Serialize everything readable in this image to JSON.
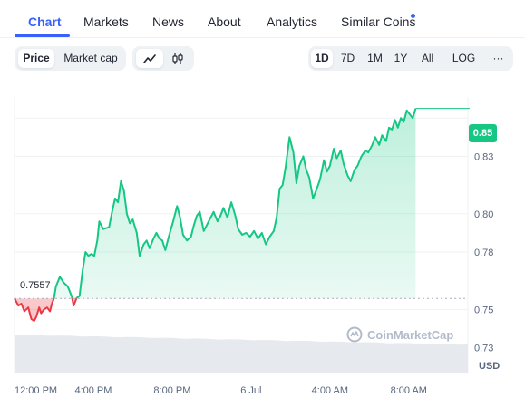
{
  "tabs": [
    {
      "label": "Chart",
      "active": true
    },
    {
      "label": "Markets",
      "active": false
    },
    {
      "label": "News",
      "active": false
    },
    {
      "label": "About",
      "active": false
    },
    {
      "label": "Analytics",
      "active": false
    },
    {
      "label": "Similar Coins",
      "active": false,
      "has_dot": true
    }
  ],
  "metric_toggle": {
    "options": [
      "Price",
      "Market cap"
    ],
    "selected": "Price"
  },
  "chart_style_toggle": {
    "options": [
      "line-chart-icon",
      "candlestick-icon"
    ],
    "selected": "line-chart-icon"
  },
  "range": {
    "options": [
      "1D",
      "7D",
      "1M",
      "1Y",
      "All"
    ],
    "selected": "1D",
    "log_label": "LOG",
    "more_label": "···"
  },
  "currency": "USD",
  "watermark": "CoinMarketCap",
  "colors": {
    "accent": "#3861fb",
    "up": "#16c784",
    "down": "#ea3943",
    "axis_text": "#58667e",
    "grid": "#eff2f5"
  },
  "chart_data": {
    "type": "line",
    "series": [
      {
        "name": "",
        "open": 0.7557,
        "current": 0.85
      }
    ],
    "current_price_label": "0.85",
    "open_price_label": "0.7557",
    "y_ticks": [
      "0.85",
      "0.83",
      "0.80",
      "0.78",
      "0.75",
      "0.73"
    ],
    "y_tick_values": [
      0.85,
      0.83,
      0.8,
      0.78,
      0.75,
      0.73
    ],
    "x_ticks": [
      "12:00 PM",
      "4:00 PM",
      "8:00 PM",
      "6 Jul",
      "4:00 AM",
      "8:00 AM"
    ],
    "x_tick_hours": [
      12,
      16,
      20,
      24,
      28,
      32
    ],
    "x_range_hours": [
      12,
      35
    ],
    "ylim": [
      0.717,
      0.861
    ],
    "grid": true,
    "points": [
      [
        12.0,
        0.7557
      ],
      [
        12.2,
        0.752
      ],
      [
        12.35,
        0.753
      ],
      [
        12.5,
        0.749
      ],
      [
        12.7,
        0.751
      ],
      [
        12.85,
        0.745
      ],
      [
        13.0,
        0.744
      ],
      [
        13.1,
        0.746
      ],
      [
        13.25,
        0.751
      ],
      [
        13.35,
        0.748
      ],
      [
        13.5,
        0.75
      ],
      [
        13.65,
        0.751
      ],
      [
        13.8,
        0.749
      ],
      [
        13.9,
        0.753
      ],
      [
        14.0,
        0.7557
      ],
      [
        14.1,
        0.762
      ],
      [
        14.3,
        0.767
      ],
      [
        14.5,
        0.764
      ],
      [
        14.7,
        0.762
      ],
      [
        14.9,
        0.757
      ],
      [
        15.0,
        0.752
      ],
      [
        15.15,
        0.756
      ],
      [
        15.3,
        0.757
      ],
      [
        15.45,
        0.77
      ],
      [
        15.6,
        0.78
      ],
      [
        15.75,
        0.778
      ],
      [
        15.9,
        0.779
      ],
      [
        16.05,
        0.778
      ],
      [
        16.2,
        0.786
      ],
      [
        16.3,
        0.796
      ],
      [
        16.5,
        0.792
      ],
      [
        16.8,
        0.793
      ],
      [
        16.95,
        0.801
      ],
      [
        17.1,
        0.808
      ],
      [
        17.25,
        0.806
      ],
      [
        17.4,
        0.817
      ],
      [
        17.55,
        0.812
      ],
      [
        17.7,
        0.8
      ],
      [
        17.85,
        0.795
      ],
      [
        18.0,
        0.797
      ],
      [
        18.2,
        0.79
      ],
      [
        18.35,
        0.778
      ],
      [
        18.55,
        0.784
      ],
      [
        18.7,
        0.786
      ],
      [
        18.85,
        0.782
      ],
      [
        19.05,
        0.787
      ],
      [
        19.2,
        0.79
      ],
      [
        19.35,
        0.787
      ],
      [
        19.5,
        0.786
      ],
      [
        19.65,
        0.781
      ],
      [
        19.85,
        0.789
      ],
      [
        20.05,
        0.796
      ],
      [
        20.25,
        0.804
      ],
      [
        20.4,
        0.798
      ],
      [
        20.55,
        0.789
      ],
      [
        20.75,
        0.786
      ],
      [
        20.95,
        0.788
      ],
      [
        21.1,
        0.794
      ],
      [
        21.25,
        0.799
      ],
      [
        21.4,
        0.801
      ],
      [
        21.6,
        0.791
      ],
      [
        21.75,
        0.794
      ],
      [
        21.95,
        0.798
      ],
      [
        22.1,
        0.801
      ],
      [
        22.3,
        0.796
      ],
      [
        22.45,
        0.799
      ],
      [
        22.6,
        0.803
      ],
      [
        22.8,
        0.798
      ],
      [
        23.0,
        0.806
      ],
      [
        23.2,
        0.799
      ],
      [
        23.35,
        0.792
      ],
      [
        23.55,
        0.789
      ],
      [
        23.75,
        0.79
      ],
      [
        23.95,
        0.788
      ],
      [
        24.15,
        0.791
      ],
      [
        24.35,
        0.787
      ],
      [
        24.55,
        0.79
      ],
      [
        24.75,
        0.784
      ],
      [
        24.95,
        0.788
      ],
      [
        25.15,
        0.791
      ],
      [
        25.3,
        0.798
      ],
      [
        25.45,
        0.813
      ],
      [
        25.6,
        0.815
      ],
      [
        25.75,
        0.824
      ],
      [
        25.95,
        0.84
      ],
      [
        26.15,
        0.832
      ],
      [
        26.3,
        0.816
      ],
      [
        26.45,
        0.825
      ],
      [
        26.65,
        0.83
      ],
      [
        26.8,
        0.823
      ],
      [
        26.95,
        0.819
      ],
      [
        27.15,
        0.808
      ],
      [
        27.3,
        0.812
      ],
      [
        27.5,
        0.818
      ],
      [
        27.7,
        0.828
      ],
      [
        27.85,
        0.822
      ],
      [
        28.0,
        0.825
      ],
      [
        28.2,
        0.834
      ],
      [
        28.35,
        0.829
      ],
      [
        28.55,
        0.833
      ],
      [
        28.7,
        0.826
      ],
      [
        28.9,
        0.82
      ],
      [
        29.05,
        0.817
      ],
      [
        29.25,
        0.823
      ],
      [
        29.4,
        0.825
      ],
      [
        29.6,
        0.83
      ],
      [
        29.8,
        0.833
      ],
      [
        29.95,
        0.832
      ],
      [
        30.15,
        0.836
      ],
      [
        30.3,
        0.84
      ],
      [
        30.5,
        0.836
      ],
      [
        30.65,
        0.841
      ],
      [
        30.85,
        0.838
      ],
      [
        31.0,
        0.845
      ],
      [
        31.15,
        0.844
      ],
      [
        31.3,
        0.849
      ],
      [
        31.45,
        0.845
      ],
      [
        31.6,
        0.85
      ],
      [
        31.75,
        0.848
      ],
      [
        31.9,
        0.854
      ],
      [
        32.05,
        0.852
      ],
      [
        32.2,
        0.85
      ],
      [
        32.35,
        0.855
      ]
    ]
  }
}
